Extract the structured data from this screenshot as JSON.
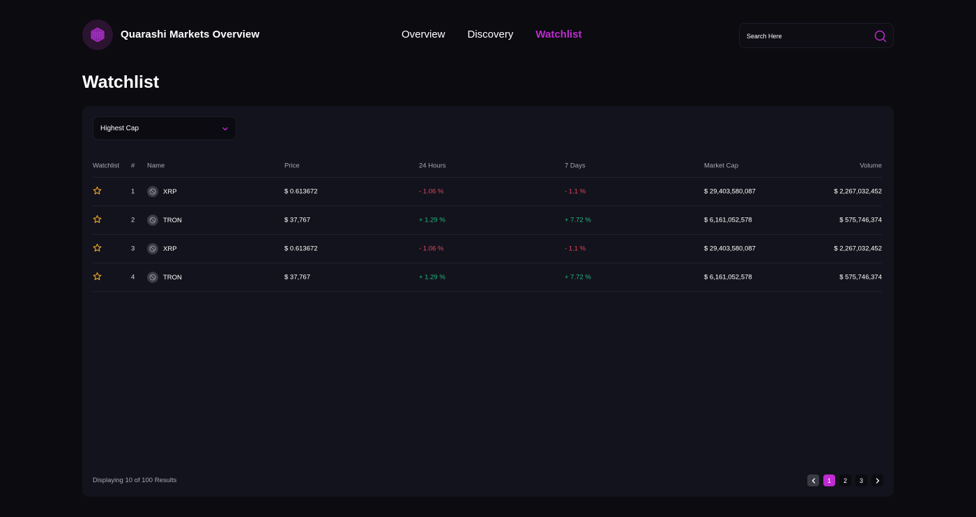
{
  "app": {
    "title": "Quarashi Markets Overview"
  },
  "nav": {
    "items": [
      {
        "label": "Overview"
      },
      {
        "label": "Discovery"
      },
      {
        "label": "Watchlist"
      }
    ],
    "active": "Watchlist"
  },
  "search": {
    "placeholder": "Search Here"
  },
  "page": {
    "title": "Watchlist"
  },
  "filter": {
    "selected": "Highest Cap"
  },
  "table": {
    "headers": {
      "watchlist": "Watchlist",
      "num": "#",
      "name": "Name",
      "price": "Price",
      "h24": "24 Hours",
      "d7": "7 Days",
      "cap": "Market Cap",
      "volume": "Volume"
    },
    "rows": [
      {
        "num": "1",
        "name": "XRP",
        "price": "$ 0.613672",
        "h24": "- 1.06 %",
        "d7": "- 1.1 %",
        "cap": "$ 29,403,580,087",
        "volume": "$ 2,267,032,452"
      },
      {
        "num": "2",
        "name": "TRON",
        "price": "$ 37,767",
        "h24": "+ 1.29 %",
        "d7": "+ 7.72 %",
        "cap": "$ 6,161,052,578",
        "volume": "$ 575,746,374"
      },
      {
        "num": "3",
        "name": "XRP",
        "price": "$ 0.613672",
        "h24": "- 1.06 %",
        "d7": "- 1.1 %",
        "cap": "$ 29,403,580,087",
        "volume": "$ 2,267,032,452"
      },
      {
        "num": "4",
        "name": "TRON",
        "price": "$ 37,767",
        "h24": "+ 1.29 %",
        "d7": "+ 7.72 %",
        "cap": "$ 6,161,052,578",
        "volume": "$ 575,746,374"
      }
    ]
  },
  "footer": {
    "results": "Displaying 10 of 100 Results"
  },
  "pagination": {
    "pages": [
      "1",
      "2",
      "3"
    ],
    "current": "1"
  },
  "colors": {
    "accent": "#c02bd1",
    "negative": "#e0465c",
    "positive": "#20b77f",
    "star": "#f0a92a"
  }
}
